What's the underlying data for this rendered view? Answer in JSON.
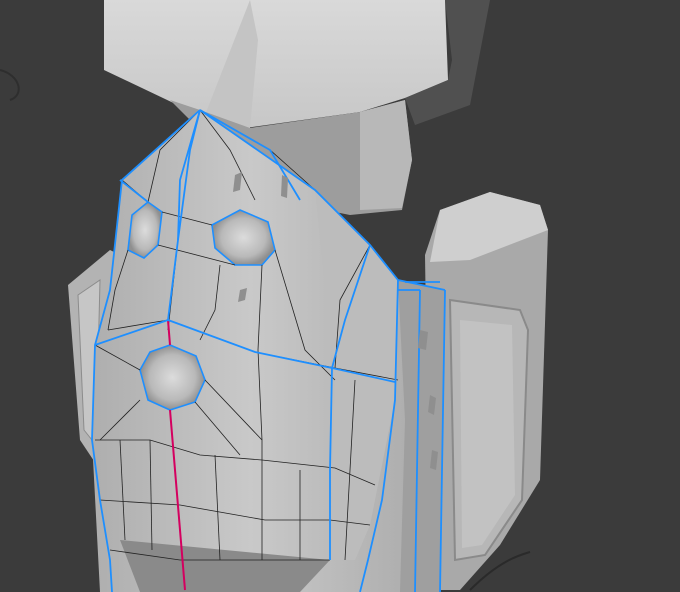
{
  "app": {
    "mode": "edit-mode",
    "view": "3d-viewport"
  },
  "viewport": {
    "background": "#3b3b3b",
    "mesh_color": "#bdbdbd",
    "mesh_shadow": "#8e8e8e",
    "edge_selected_color": "#1e8fff",
    "edge_wire_color": "#222222",
    "edge_seam_color": "#d4005f",
    "selection": "face-set-selected"
  }
}
